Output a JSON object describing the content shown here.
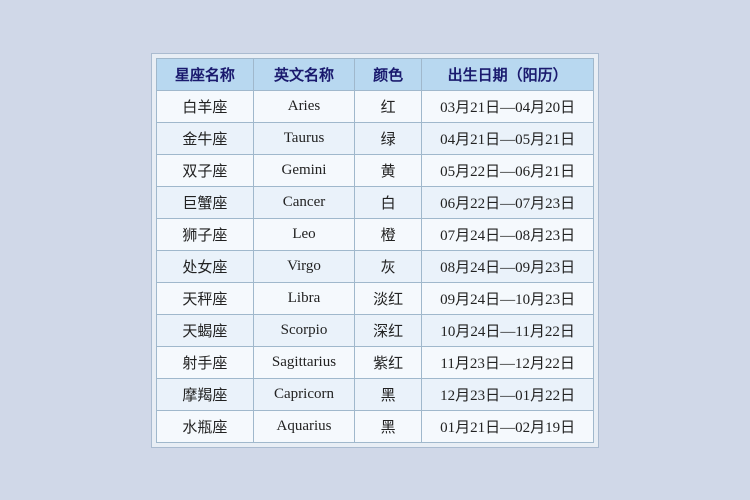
{
  "table": {
    "headers": {
      "zh_name": "星座名称",
      "en_name": "英文名称",
      "color": "颜色",
      "date_range": "出生日期（阳历）"
    },
    "rows": [
      {
        "zh": "白羊座",
        "en": "Aries",
        "color": "红",
        "date": "03月21日—04月20日"
      },
      {
        "zh": "金牛座",
        "en": "Taurus",
        "color": "绿",
        "date": "04月21日—05月21日"
      },
      {
        "zh": "双子座",
        "en": "Gemini",
        "color": "黄",
        "date": "05月22日—06月21日"
      },
      {
        "zh": "巨蟹座",
        "en": "Cancer",
        "color": "白",
        "date": "06月22日—07月23日"
      },
      {
        "zh": "狮子座",
        "en": "Leo",
        "color": "橙",
        "date": "07月24日—08月23日"
      },
      {
        "zh": "处女座",
        "en": "Virgo",
        "color": "灰",
        "date": "08月24日—09月23日"
      },
      {
        "zh": "天秤座",
        "en": "Libra",
        "color": "淡红",
        "date": "09月24日—10月23日"
      },
      {
        "zh": "天蝎座",
        "en": "Scorpio",
        "color": "深红",
        "date": "10月24日—11月22日"
      },
      {
        "zh": "射手座",
        "en": "Sagittarius",
        "color": "紫红",
        "date": "11月23日—12月22日"
      },
      {
        "zh": "摩羯座",
        "en": "Capricorn",
        "color": "黑",
        "date": "12月23日—01月22日"
      },
      {
        "zh": "水瓶座",
        "en": "Aquarius",
        "color": "黑",
        "date": "01月21日—02月19日"
      }
    ]
  }
}
